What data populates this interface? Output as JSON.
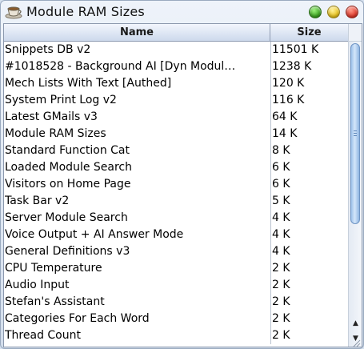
{
  "window": {
    "title": "Module RAM Sizes",
    "buttons": [
      "maximize",
      "minimize",
      "close"
    ]
  },
  "table": {
    "columns": [
      "Name",
      "Size"
    ],
    "rows": [
      {
        "name": "Snippets DB v2",
        "size": "11501 K"
      },
      {
        "name": "#1018528 - Background AI [Dyn Modul…",
        "size": "1238 K"
      },
      {
        "name": "Mech Lists With Text [Authed]",
        "size": "120 K"
      },
      {
        "name": "System Print Log v2",
        "size": "116 K"
      },
      {
        "name": "Latest GMails v3",
        "size": "64 K"
      },
      {
        "name": "Module RAM Sizes",
        "size": "14 K"
      },
      {
        "name": "Standard Function Cat",
        "size": "8 K"
      },
      {
        "name": "Loaded Module Search",
        "size": "6 K"
      },
      {
        "name": "Visitors on Home Page",
        "size": "6 K"
      },
      {
        "name": "Task Bar v2",
        "size": "5 K"
      },
      {
        "name": "Server Module Search",
        "size": "4 K"
      },
      {
        "name": "Voice Output + AI Answer Mode",
        "size": "4 K"
      },
      {
        "name": "General Definitions v3",
        "size": "4 K"
      },
      {
        "name": "CPU Temperature",
        "size": "2 K"
      },
      {
        "name": "Audio Input",
        "size": "2 K"
      },
      {
        "name": "Stefan's Assistant",
        "size": "2 K"
      },
      {
        "name": "Categories For Each Word",
        "size": "2 K"
      },
      {
        "name": "Thread Count",
        "size": "2 K"
      }
    ]
  },
  "icons": {
    "app": "coffee-cup-icon",
    "scroll_up": "arrow-up-icon",
    "scroll_down": "arrow-down-icon"
  },
  "colors": {
    "header_bg": "#cdd9ec",
    "window_bg": "#d6e1ef",
    "thumb": "#9fc2ea"
  }
}
